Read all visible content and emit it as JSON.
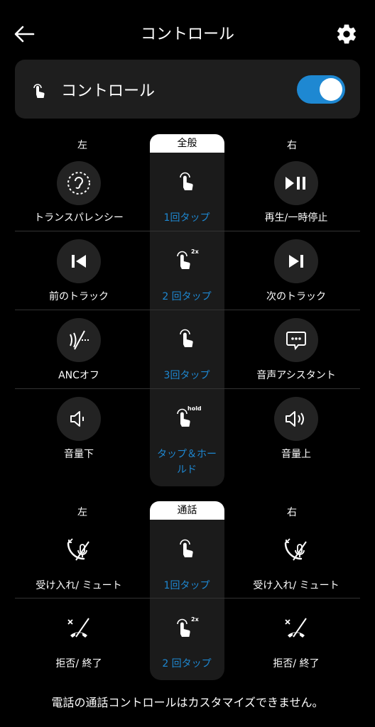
{
  "header": {
    "title": "コントロール"
  },
  "card": {
    "label": "コントロール",
    "toggle_on": true
  },
  "section1": {
    "left_head": "左",
    "center_head": "全般",
    "right_head": "右",
    "rows": [
      {
        "left": "トランスパレンシー",
        "center": "1回タップ",
        "right": "再生/一時停止"
      },
      {
        "left": "前のトラック",
        "center": "2 回タップ",
        "right": "次のトラック"
      },
      {
        "left": "ANCオフ",
        "center": "3回タップ",
        "right": "音声アシスタント"
      },
      {
        "left": "音量下",
        "center": "タップ＆ホー",
        "center2": "ルド",
        "right": "音量上"
      }
    ]
  },
  "section2": {
    "left_head": "左",
    "center_head": "通話",
    "right_head": "右",
    "rows": [
      {
        "left": "受け入れ/ ミュート",
        "center": "1回タップ",
        "right": "受け入れ/ ミュート"
      },
      {
        "left": "拒否/ 終了",
        "center": "2 回タップ",
        "right": "拒否/ 終了"
      }
    ]
  },
  "gesture_tags": {
    "double": "2x",
    "hold": "hold"
  },
  "footer": {
    "note": "電話の通話コントロールはカスタマイズできません。"
  },
  "colors": {
    "accent": "#1e88d2",
    "background": "#000000",
    "card": "#1e1e1e"
  }
}
